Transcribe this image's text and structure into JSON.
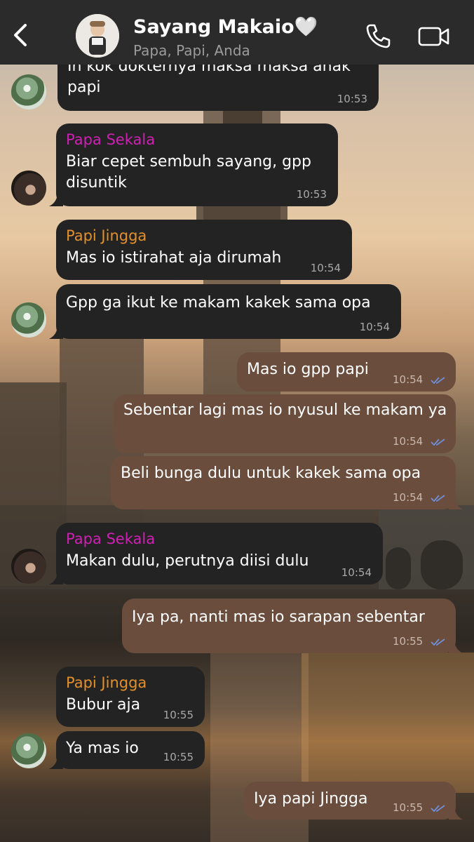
{
  "header": {
    "title": "Sayang Makaio🤍",
    "subtitle": "Papa, Papi, Anda",
    "back_icon": "chevron-left-icon",
    "call_icon": "phone-icon",
    "video_icon": "video-camera-icon"
  },
  "messages": [
    {
      "sender": "",
      "text": "In kok dokternya maksa maksa anak papi",
      "time": "10:53",
      "direction": "in"
    },
    {
      "sender": "Papa Sekala",
      "text": "Biar cepet sembuh sayang, gpp disuntik",
      "time": "10:53",
      "direction": "in"
    },
    {
      "sender": "Papi Jingga",
      "text": "Mas io istirahat aja dirumah",
      "time": "10:54",
      "direction": "in"
    },
    {
      "sender": "",
      "text": "Gpp ga ikut ke makam kakek sama opa",
      "time": "10:54",
      "direction": "in"
    },
    {
      "sender": "",
      "text": "Mas io gpp papi",
      "time": "10:54",
      "direction": "out"
    },
    {
      "sender": "",
      "text": "Sebentar lagi mas io nyusul ke makam ya",
      "time": "10:54",
      "direction": "out"
    },
    {
      "sender": "",
      "text": "Beli bunga dulu untuk kakek sama opa",
      "time": "10:54",
      "direction": "out"
    },
    {
      "sender": "Papa Sekala",
      "text": "Makan dulu, perutnya diisi dulu",
      "time": "10:54",
      "direction": "in"
    },
    {
      "sender": "",
      "text": "Iya pa, nanti mas io sarapan sebentar",
      "time": "10:55",
      "direction": "out"
    },
    {
      "sender": "Papi Jingga",
      "text": "Bubur aja",
      "time": "10:55",
      "direction": "in"
    },
    {
      "sender": "",
      "text": "Ya mas io",
      "time": "10:55",
      "direction": "in"
    },
    {
      "sender": "",
      "text": "Iya papi Jingga",
      "time": "10:55",
      "direction": "out"
    }
  ],
  "colors": {
    "incoming_bubble": "#232323",
    "outgoing_bubble": "#6b4d3d",
    "papa_sekala_name": "#d01fb5",
    "papi_jingga_name": "#e3902a",
    "read_ticks": "#6f8fd8"
  }
}
